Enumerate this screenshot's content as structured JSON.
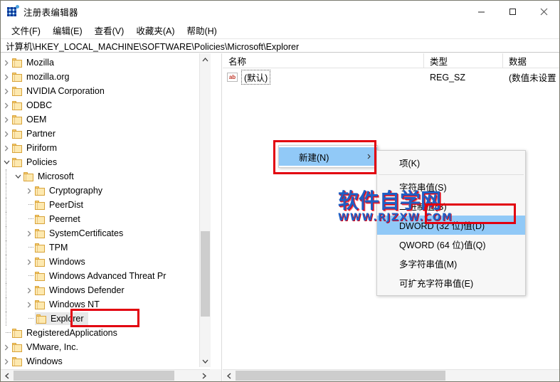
{
  "window": {
    "title": "注册表编辑器",
    "icon": "registry-editor-icon",
    "buttons": {
      "minimize": "minimize-icon",
      "maximize": "maximize-icon",
      "close": "close-icon"
    }
  },
  "menubar": {
    "items": [
      {
        "label": "文件(F)"
      },
      {
        "label": "编辑(E)"
      },
      {
        "label": "查看(V)"
      },
      {
        "label": "收藏夹(A)"
      },
      {
        "label": "帮助(H)"
      }
    ]
  },
  "address": {
    "path": "计算机\\HKEY_LOCAL_MACHINE\\SOFTWARE\\Policies\\Microsoft\\Explorer"
  },
  "tree": {
    "nodes": [
      {
        "label": "Mozilla",
        "indent": 0,
        "expander": "collapsed",
        "selected": false
      },
      {
        "label": "mozilla.org",
        "indent": 0,
        "expander": "collapsed",
        "selected": false
      },
      {
        "label": "NVIDIA Corporation",
        "indent": 0,
        "expander": "collapsed",
        "selected": false
      },
      {
        "label": "ODBC",
        "indent": 0,
        "expander": "collapsed",
        "selected": false
      },
      {
        "label": "OEM",
        "indent": 0,
        "expander": "collapsed",
        "selected": false
      },
      {
        "label": "Partner",
        "indent": 0,
        "expander": "collapsed",
        "selected": false
      },
      {
        "label": "Piriform",
        "indent": 0,
        "expander": "collapsed",
        "selected": false
      },
      {
        "label": "Policies",
        "indent": 0,
        "expander": "expanded",
        "selected": false
      },
      {
        "label": "Microsoft",
        "indent": 1,
        "expander": "expanded",
        "selected": false
      },
      {
        "label": "Cryptography",
        "indent": 2,
        "expander": "collapsed",
        "selected": false
      },
      {
        "label": "PeerDist",
        "indent": 2,
        "expander": "leaf",
        "selected": false
      },
      {
        "label": "Peernet",
        "indent": 2,
        "expander": "leaf",
        "selected": false
      },
      {
        "label": "SystemCertificates",
        "indent": 2,
        "expander": "collapsed",
        "selected": false
      },
      {
        "label": "TPM",
        "indent": 2,
        "expander": "leaf",
        "selected": false
      },
      {
        "label": "Windows",
        "indent": 2,
        "expander": "collapsed",
        "selected": false
      },
      {
        "label": "Windows Advanced Threat Pr",
        "indent": 2,
        "expander": "leaf",
        "selected": false
      },
      {
        "label": "Windows Defender",
        "indent": 2,
        "expander": "collapsed",
        "selected": false
      },
      {
        "label": "Windows NT",
        "indent": 2,
        "expander": "collapsed",
        "selected": false
      },
      {
        "label": "Explorer",
        "indent": 2,
        "expander": "leaf",
        "selected": true
      },
      {
        "label": "RegisteredApplications",
        "indent": 0,
        "expander": "leaf",
        "selected": false
      },
      {
        "label": "VMware, Inc.",
        "indent": 0,
        "expander": "collapsed",
        "selected": false
      },
      {
        "label": "Windows",
        "indent": 0,
        "expander": "collapsed",
        "selected": false
      }
    ]
  },
  "list": {
    "columns": [
      {
        "label": "名称"
      },
      {
        "label": "类型"
      },
      {
        "label": "数据"
      }
    ],
    "rows": [
      {
        "icon": "string-value-icon",
        "name": "(默认)",
        "type": "REG_SZ",
        "data": "(数值未设置"
      }
    ]
  },
  "context_menu": {
    "items": [
      {
        "label": "新建(N)",
        "highlighted": true,
        "has_submenu": true
      }
    ]
  },
  "submenu": {
    "items": [
      {
        "label": "项(K)",
        "highlighted": false,
        "separator_after": true
      },
      {
        "label": "字符串值(S)",
        "highlighted": false,
        "separator_after": false
      },
      {
        "label": "二进制值(B)",
        "highlighted": false,
        "separator_after": false
      },
      {
        "label": "DWORD (32 位)值(D)",
        "highlighted": true,
        "separator_after": false
      },
      {
        "label": "QWORD (64 位)值(Q)",
        "highlighted": false,
        "separator_after": false
      },
      {
        "label": "多字符串值(M)",
        "highlighted": false,
        "separator_after": false
      },
      {
        "label": "可扩充字符串值(E)",
        "highlighted": false,
        "separator_after": false
      }
    ]
  },
  "annotations": {
    "color": "#e2000f",
    "boxes": [
      {
        "target": "新建(N)"
      },
      {
        "target": "DWORD (32 位)值(D)"
      },
      {
        "target": "Explorer"
      }
    ]
  },
  "watermark": {
    "main": "软件自学网",
    "sub": "WWW.RJZXW.COM",
    "main_color": "#1f5fc4",
    "accent_color": "#e2000f"
  }
}
